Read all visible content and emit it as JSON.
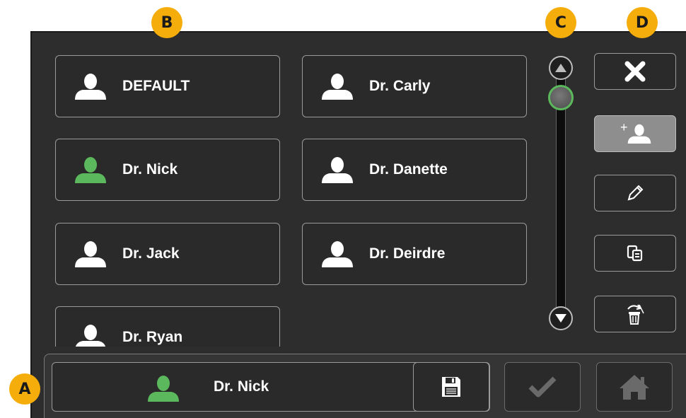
{
  "callouts": {
    "a": "A",
    "b": "B",
    "c": "C",
    "d": "D"
  },
  "users": [
    {
      "name": "DEFAULT",
      "selected": false
    },
    {
      "name": "Dr. Carly",
      "selected": false
    },
    {
      "name": "Dr. Nick",
      "selected": true
    },
    {
      "name": "Dr. Danette",
      "selected": false
    },
    {
      "name": "Dr. Jack",
      "selected": false
    },
    {
      "name": "Dr. Deirdre",
      "selected": false
    },
    {
      "name": "Dr. Ryan",
      "selected": false
    }
  ],
  "current_user": {
    "name": "Dr. Nick"
  },
  "tools": [
    {
      "icon": "close-icon"
    },
    {
      "icon": "add-user-icon",
      "active": true,
      "plus": "+"
    },
    {
      "icon": "pencil-icon"
    },
    {
      "icon": "copy-icon"
    },
    {
      "icon": "trash-icon"
    }
  ],
  "colors": {
    "callout": "#f5ad0c",
    "selected_user": "#5cb85c",
    "panel": "#2d2d2d",
    "disabled": "#6a6a6a"
  }
}
